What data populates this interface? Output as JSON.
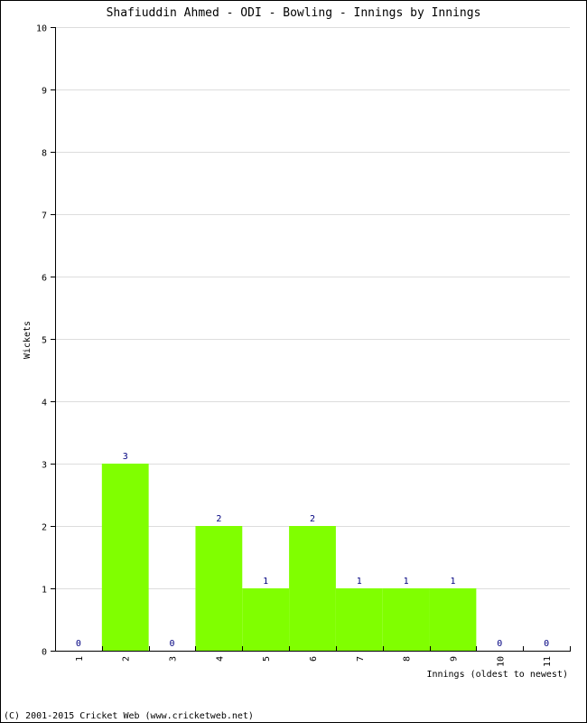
{
  "chart_data": {
    "type": "bar",
    "title": "Shafiuddin Ahmed - ODI - Bowling - Innings by Innings",
    "xlabel": "Innings (oldest to newest)",
    "ylabel": "Wickets",
    "categories": [
      "1",
      "2",
      "3",
      "4",
      "5",
      "6",
      "7",
      "8",
      "9",
      "10",
      "11"
    ],
    "values": [
      0,
      3,
      0,
      2,
      1,
      2,
      1,
      1,
      1,
      0,
      0
    ],
    "data_labels": [
      "0",
      "3",
      "0",
      "2",
      "1",
      "2",
      "1",
      "1",
      "1",
      "0",
      "0"
    ],
    "ylim": [
      0,
      10
    ],
    "yticks": [
      0,
      1,
      2,
      3,
      4,
      5,
      6,
      7,
      8,
      9,
      10
    ],
    "grid": true,
    "legend": "none",
    "colors": {
      "bar": "#80ff00",
      "grid": "#dddddd",
      "axis": "#000000",
      "data_label": "#000080",
      "text": "#000000"
    }
  },
  "footer": {
    "copyright": "(C) 2001-2015 Cricket Web (www.cricketweb.net)"
  }
}
